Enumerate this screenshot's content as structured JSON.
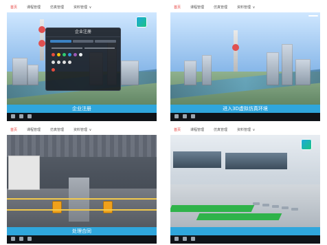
{
  "nav": {
    "tabs": [
      "首页",
      "课程管理",
      "仿真管理",
      "资料管理"
    ],
    "active_index": 0,
    "dropdown_indicator": "∨"
  },
  "panels": [
    {
      "caption": "企业注册",
      "has_dialog": true,
      "dialog_title": "企业注册"
    },
    {
      "caption": "进入3D虚拟仿真环境"
    },
    {
      "caption": "处理合同"
    },
    {
      "caption": ""
    }
  ]
}
